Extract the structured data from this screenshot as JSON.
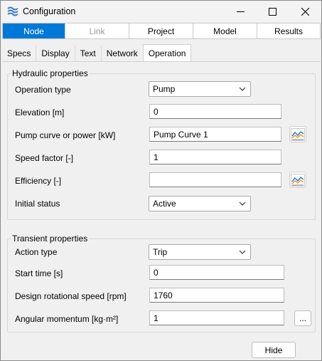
{
  "window": {
    "title": "Configuration"
  },
  "nav": {
    "items": [
      {
        "label": "Node",
        "state": "active"
      },
      {
        "label": "Link",
        "state": "disabled"
      },
      {
        "label": "Project",
        "state": "normal"
      },
      {
        "label": "Model",
        "state": "normal"
      },
      {
        "label": "Results",
        "state": "normal"
      }
    ]
  },
  "subtabs": {
    "items": [
      "Specs",
      "Display",
      "Text",
      "Network",
      "Operation"
    ],
    "active": "Operation"
  },
  "hydraulic": {
    "legend": "Hydraulic properties",
    "operation_type": {
      "label": "Operation type",
      "value": "Pump"
    },
    "elevation": {
      "label": "Elevation [m]",
      "value": "0"
    },
    "pump_curve": {
      "label": "Pump curve or power [kW]",
      "value": "Pump Curve 1"
    },
    "speed_factor": {
      "label": "Speed factor [-]",
      "value": "1"
    },
    "efficiency": {
      "label": "Efficiency [-]",
      "value": ""
    },
    "initial_status": {
      "label": "Initial status",
      "value": "Active"
    }
  },
  "transient": {
    "legend": "Transient properties",
    "action_type": {
      "label": "Action type",
      "value": "Trip"
    },
    "start_time": {
      "label": "Start time [s]",
      "value": "0"
    },
    "design_speed": {
      "label": "Design rotational speed [rpm]",
      "value": "1760"
    },
    "angular_momentum": {
      "label": "Angular momentum [kg·m²]",
      "value": "1",
      "button": "..."
    }
  },
  "footer": {
    "hide_label": "Hide"
  },
  "colors": {
    "accent": "#0078d7",
    "background": "#f0f0f0"
  }
}
